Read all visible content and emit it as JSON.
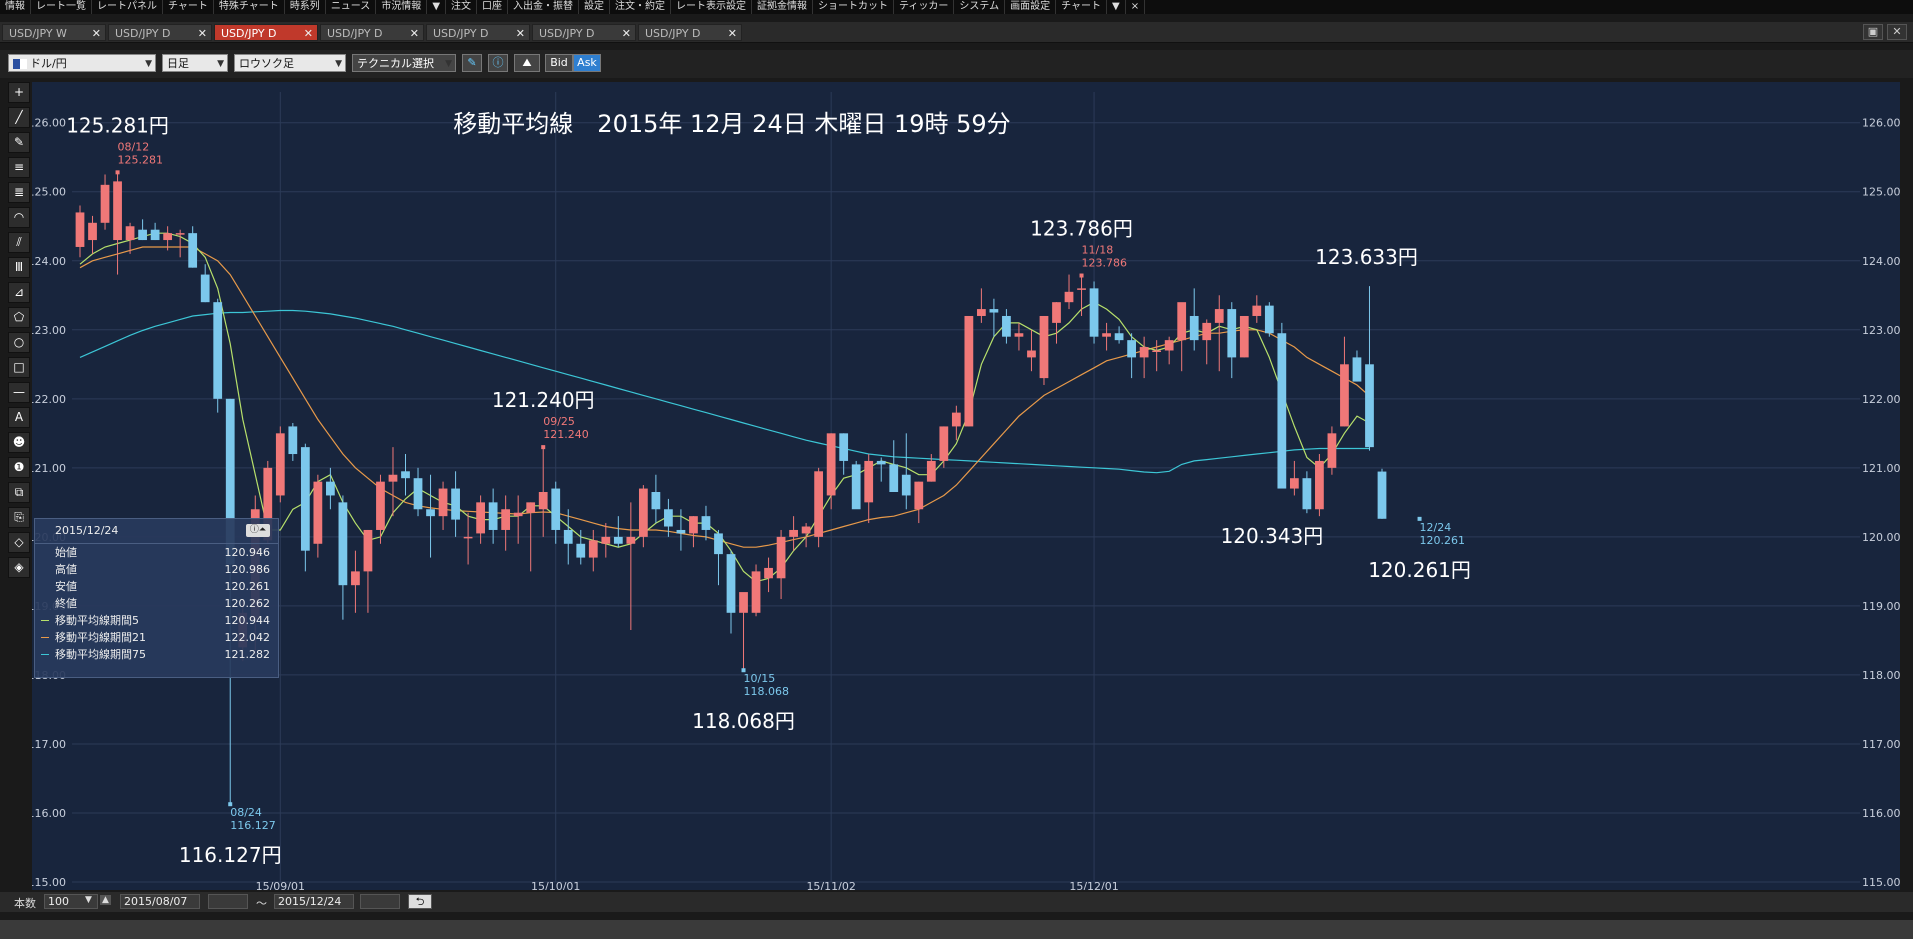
{
  "menu": [
    "情報",
    "レート一覧",
    "レートパネル",
    "チャート",
    "特殊チャート",
    "時系列",
    "ニュース",
    "市況情報",
    "▼",
    "注文",
    "口座",
    "入出金・振替",
    "設定",
    "注文・約定",
    "レート表示設定",
    "証拠金情報",
    "ショートカット",
    "ティッカー",
    "システム",
    "画面設定",
    "チャート",
    "▼",
    "×"
  ],
  "tabs": [
    {
      "label": "USD/JPY W",
      "active": false
    },
    {
      "label": "USD/JPY D",
      "active": false
    },
    {
      "label": "USD/JPY D",
      "active": true
    },
    {
      "label": "USD/JPY D",
      "active": false
    },
    {
      "label": "USD/JPY D",
      "active": false
    },
    {
      "label": "USD/JPY D",
      "active": false
    },
    {
      "label": "USD/JPY D",
      "active": false
    }
  ],
  "toolbar": {
    "pair": "ドル/円",
    "period": "日足",
    "chart_type": "ロウソク足",
    "technical": "テクニカル選択",
    "bid": "Bid",
    "ask": "Ask"
  },
  "left_tools": [
    "+",
    "╱",
    "✎",
    "≡",
    "≣",
    "◠",
    "⫽",
    "Ⅲ",
    "⊿",
    "⬠",
    "○",
    "□",
    "—",
    "A",
    "☻",
    "❶",
    "⧉",
    "⎘",
    "◇",
    "◈"
  ],
  "bottom": {
    "count_label": "本数",
    "count_value": "100",
    "from_date": "2015/08/07",
    "tilde": "～",
    "to_date": "2015/12/24"
  },
  "info_panel": {
    "date": "2015/12/24",
    "rows": [
      {
        "label": "始値",
        "value": "120.946",
        "color": ""
      },
      {
        "label": "高値",
        "value": "120.986",
        "color": ""
      },
      {
        "label": "安値",
        "value": "120.261",
        "color": ""
      },
      {
        "label": "終値",
        "value": "120.262",
        "color": ""
      },
      {
        "label": "移動平均線期間5",
        "value": "120.944",
        "color": "#b7e06b"
      },
      {
        "label": "移動平均線期間21",
        "value": "122.042",
        "color": "#e89a4a"
      },
      {
        "label": "移動平均線期間75",
        "value": "121.282",
        "color": "#3cc6d6"
      }
    ]
  },
  "chart_data": {
    "type": "candlestick",
    "title": "移動平均線　2015年 12月 24日 木曜日 19時 59分",
    "ylim": [
      115,
      126.3
    ],
    "yticks": [
      "115.00",
      "116.00",
      "117.00",
      "118.00",
      "119.00",
      "120.00",
      "121.00",
      "122.00",
      "123.00",
      "124.00",
      "125.00",
      "126.00"
    ],
    "xticks": [
      {
        "label": "15/09/01",
        "i": 16
      },
      {
        "label": "15/10/01",
        "i": 38
      },
      {
        "label": "15/11/02",
        "i": 60
      },
      {
        "label": "15/12/01",
        "i": 81
      }
    ],
    "colors": {
      "up": "#f07878",
      "down": "#7cc8ec",
      "ma5": "#b7e06b",
      "ma21": "#e89a4a",
      "ma75": "#3cc6d6",
      "grid": "#2c3b58",
      "text": "#c8cfdc"
    },
    "candles": [
      [
        124.2,
        124.8,
        124.05,
        124.7
      ],
      [
        124.3,
        124.65,
        124.1,
        124.55
      ],
      [
        124.55,
        125.25,
        124.45,
        125.1
      ],
      [
        124.3,
        125.281,
        123.8,
        125.15
      ],
      [
        124.3,
        124.55,
        124.1,
        124.5
      ],
      [
        124.45,
        124.6,
        124.3,
        124.3
      ],
      [
        124.45,
        124.55,
        124.3,
        124.3
      ],
      [
        124.3,
        124.5,
        124.15,
        124.4
      ],
      [
        124.4,
        124.45,
        124.05,
        124.4
      ],
      [
        124.4,
        124.5,
        123.9,
        123.9
      ],
      [
        123.8,
        123.95,
        123.4,
        123.4
      ],
      [
        123.4,
        123.45,
        121.8,
        122.0
      ],
      [
        122.0,
        122.0,
        116.127,
        119.6
      ],
      [
        118.4,
        119.1,
        118.2,
        118.9
      ],
      [
        118.8,
        120.6,
        118.3,
        120.4
      ],
      [
        119.95,
        121.1,
        119.9,
        121.0
      ],
      [
        120.6,
        121.6,
        120.5,
        121.5
      ],
      [
        121.6,
        121.65,
        121.1,
        121.2
      ],
      [
        121.3,
        121.35,
        119.5,
        119.8
      ],
      [
        119.9,
        120.9,
        119.7,
        120.8
      ],
      [
        120.8,
        121.0,
        120.4,
        120.6
      ],
      [
        120.5,
        120.6,
        118.8,
        119.3
      ],
      [
        119.3,
        119.8,
        118.9,
        119.5
      ],
      [
        119.5,
        120.1,
        118.9,
        120.1
      ],
      [
        120.1,
        120.9,
        119.9,
        120.8
      ],
      [
        120.8,
        121.3,
        120.3,
        120.9
      ],
      [
        120.95,
        121.2,
        120.6,
        120.85
      ],
      [
        120.85,
        121.0,
        120.3,
        120.4
      ],
      [
        120.4,
        120.9,
        119.7,
        120.3
      ],
      [
        120.3,
        120.8,
        120.1,
        120.7
      ],
      [
        120.7,
        120.95,
        120.0,
        120.25
      ],
      [
        120.0,
        120.35,
        119.6,
        120.0
      ],
      [
        120.05,
        120.6,
        119.9,
        120.5
      ],
      [
        120.5,
        120.7,
        119.9,
        120.1
      ],
      [
        120.1,
        120.6,
        119.8,
        120.4
      ],
      [
        120.3,
        120.6,
        119.9,
        120.35
      ],
      [
        120.35,
        120.5,
        119.5,
        120.5
      ],
      [
        120.4,
        121.3,
        120.0,
        120.65
      ],
      [
        120.7,
        120.8,
        119.9,
        120.1
      ],
      [
        120.1,
        120.4,
        119.6,
        119.9
      ],
      [
        119.9,
        120.1,
        119.6,
        119.7
      ],
      [
        119.7,
        120.1,
        119.5,
        119.95
      ],
      [
        119.9,
        120.2,
        119.7,
        120.0
      ],
      [
        120.0,
        120.3,
        119.85,
        119.9
      ],
      [
        119.9,
        120.5,
        118.65,
        120.0
      ],
      [
        120.0,
        120.75,
        119.85,
        120.7
      ],
      [
        120.65,
        120.9,
        120.2,
        120.4
      ],
      [
        120.4,
        120.55,
        120.0,
        120.15
      ],
      [
        120.1,
        120.4,
        119.8,
        120.05
      ],
      [
        120.05,
        120.3,
        119.85,
        120.3
      ],
      [
        120.3,
        120.45,
        119.95,
        120.1
      ],
      [
        120.05,
        120.1,
        119.3,
        119.75
      ],
      [
        119.75,
        119.8,
        118.6,
        118.9
      ],
      [
        118.9,
        119.0,
        118.068,
        119.2
      ],
      [
        118.9,
        119.6,
        118.85,
        119.5
      ],
      [
        119.4,
        119.7,
        119.2,
        119.55
      ],
      [
        119.4,
        120.1,
        119.1,
        120.0
      ],
      [
        120.0,
        120.3,
        119.8,
        120.1
      ],
      [
        120.05,
        120.2,
        119.85,
        120.15
      ],
      [
        120.0,
        121.0,
        119.85,
        120.95
      ],
      [
        120.6,
        121.5,
        120.4,
        121.5
      ],
      [
        121.5,
        121.5,
        120.9,
        121.1
      ],
      [
        121.05,
        121.1,
        120.5,
        120.4
      ],
      [
        120.5,
        121.2,
        120.2,
        121.1
      ],
      [
        121.1,
        121.15,
        120.8,
        121.05
      ],
      [
        121.05,
        121.4,
        120.8,
        120.65
      ],
      [
        120.9,
        121.5,
        120.4,
        120.6
      ],
      [
        120.4,
        120.8,
        120.2,
        120.8
      ],
      [
        120.8,
        121.2,
        120.8,
        121.1
      ],
      [
        121.1,
        121.6,
        121.0,
        121.6
      ],
      [
        121.6,
        121.9,
        121.4,
        121.8
      ],
      [
        121.6,
        123.2,
        121.6,
        123.2
      ],
      [
        123.2,
        123.6,
        123.1,
        123.3
      ],
      [
        123.3,
        123.45,
        122.9,
        123.25
      ],
      [
        123.2,
        123.3,
        122.8,
        122.9
      ],
      [
        122.9,
        123.1,
        122.7,
        122.95
      ],
      [
        122.6,
        123.0,
        122.4,
        122.7
      ],
      [
        122.3,
        123.2,
        122.2,
        123.2
      ],
      [
        123.1,
        123.4,
        122.8,
        123.4
      ],
      [
        123.4,
        123.8,
        123.3,
        123.55
      ],
      [
        123.6,
        123.786,
        123.2,
        123.6
      ],
      [
        123.6,
        123.7,
        122.8,
        122.9
      ],
      [
        122.9,
        123.1,
        122.7,
        122.95
      ],
      [
        122.95,
        123.05,
        122.8,
        122.85
      ],
      [
        122.85,
        122.95,
        122.3,
        122.6
      ],
      [
        122.6,
        122.9,
        122.3,
        122.75
      ],
      [
        122.7,
        122.85,
        122.4,
        122.7
      ],
      [
        122.7,
        122.9,
        122.5,
        122.85
      ],
      [
        122.85,
        123.3,
        122.4,
        123.4
      ],
      [
        123.2,
        123.6,
        122.7,
        122.85
      ],
      [
        122.85,
        123.15,
        122.5,
        123.1
      ],
      [
        123.1,
        123.5,
        122.4,
        123.3
      ],
      [
        123.3,
        123.4,
        122.3,
        122.6
      ],
      [
        122.6,
        123.2,
        122.6,
        123.2
      ],
      [
        123.2,
        123.5,
        123.1,
        123.35
      ],
      [
        123.35,
        123.4,
        122.9,
        122.95
      ],
      [
        122.95,
        123.1,
        120.8,
        120.7
      ],
      [
        120.7,
        121.1,
        120.6,
        120.85
      ],
      [
        120.85,
        120.95,
        120.343,
        120.4
      ],
      [
        120.4,
        121.2,
        120.3,
        121.1
      ],
      [
        121.0,
        121.6,
        120.9,
        121.5
      ],
      [
        121.6,
        122.9,
        121.6,
        122.5
      ],
      [
        122.6,
        122.7,
        122.25,
        122.25
      ],
      [
        122.5,
        123.633,
        121.25,
        121.3
      ]
    ],
    "ma5_start": [
      0,
      123.95
    ],
    "ma5": [
      123.95,
      124.1,
      124.2,
      124.25,
      124.3,
      124.35,
      124.4,
      124.4,
      124.35,
      124.25,
      124.05,
      123.6,
      122.8,
      121.7,
      120.9,
      120.1,
      120.1,
      120.4,
      120.5,
      120.8,
      120.9,
      120.5,
      120.2,
      119.95,
      120.0,
      120.35,
      120.55,
      120.7,
      120.6,
      120.5,
      120.45,
      120.3,
      120.25,
      120.25,
      120.3,
      120.3,
      120.45,
      120.45,
      120.3,
      120.15,
      120.0,
      119.95,
      119.9,
      119.85,
      119.9,
      120.05,
      120.2,
      120.3,
      120.3,
      120.2,
      120.2,
      120.05,
      119.8,
      119.5,
      119.35,
      119.4,
      119.55,
      119.8,
      120.0,
      120.3,
      120.6,
      120.85,
      120.9,
      121.0,
      121.1,
      121.05,
      121.0,
      120.9,
      120.9,
      121.1,
      121.35,
      121.8,
      122.5,
      122.9,
      123.1,
      123.1,
      123.0,
      122.9,
      122.95,
      123.1,
      123.3,
      123.4,
      123.3,
      123.15,
      122.9,
      122.75,
      122.7,
      122.75,
      122.95,
      123.0,
      122.95,
      123.05,
      123.0,
      123.05,
      123.0,
      122.6,
      122.1,
      121.6,
      121.15,
      121.0,
      121.2,
      121.5,
      121.75,
      121.65
    ],
    "ma21": [
      123.9,
      124.0,
      124.05,
      124.1,
      124.15,
      124.2,
      124.2,
      124.2,
      124.2,
      124.2,
      124.1,
      124.0,
      123.8,
      123.5,
      123.2,
      122.9,
      122.6,
      122.3,
      122.0,
      121.7,
      121.45,
      121.2,
      121.0,
      120.85,
      120.7,
      120.6,
      120.5,
      120.45,
      120.42,
      120.4,
      120.38,
      120.37,
      120.36,
      120.35,
      120.34,
      120.33,
      120.35,
      120.36,
      120.35,
      120.3,
      120.25,
      120.2,
      120.15,
      120.12,
      120.1,
      120.1,
      120.1,
      120.08,
      120.05,
      120.02,
      120.0,
      119.95,
      119.9,
      119.85,
      119.85,
      119.88,
      119.92,
      119.96,
      120.0,
      120.05,
      120.1,
      120.15,
      120.2,
      120.25,
      120.28,
      120.3,
      120.35,
      120.4,
      120.5,
      120.6,
      120.75,
      120.95,
      121.15,
      121.35,
      121.55,
      121.75,
      121.9,
      122.05,
      122.15,
      122.25,
      122.35,
      122.45,
      122.55,
      122.6,
      122.65,
      122.7,
      122.75,
      122.8,
      122.85,
      122.9,
      122.95,
      122.95,
      122.98,
      123.0,
      123.0,
      122.95,
      122.85,
      122.75,
      122.6,
      122.5,
      122.4,
      122.3,
      122.2,
      122.04
    ],
    "ma75": [
      122.6,
      122.68,
      122.76,
      122.84,
      122.92,
      122.99,
      123.05,
      123.1,
      123.15,
      123.2,
      123.22,
      123.24,
      123.25,
      123.25,
      123.26,
      123.27,
      123.28,
      123.28,
      123.27,
      123.25,
      123.23,
      123.2,
      123.17,
      123.13,
      123.09,
      123.05,
      123.0,
      122.95,
      122.9,
      122.85,
      122.8,
      122.75,
      122.7,
      122.65,
      122.6,
      122.55,
      122.5,
      122.45,
      122.4,
      122.35,
      122.3,
      122.25,
      122.2,
      122.15,
      122.1,
      122.05,
      122.0,
      121.95,
      121.9,
      121.85,
      121.8,
      121.75,
      121.7,
      121.65,
      121.6,
      121.55,
      121.5,
      121.45,
      121.4,
      121.36,
      121.32,
      121.28,
      121.24,
      121.2,
      121.18,
      121.16,
      121.15,
      121.14,
      121.13,
      121.12,
      121.11,
      121.1,
      121.09,
      121.08,
      121.07,
      121.06,
      121.05,
      121.04,
      121.03,
      121.02,
      121.01,
      121.0,
      120.99,
      120.98,
      120.96,
      120.94,
      120.93,
      120.95,
      121.05,
      121.1,
      121.12,
      121.14,
      121.16,
      121.18,
      121.2,
      121.22,
      121.24,
      121.26,
      121.27,
      121.28,
      121.28,
      121.28,
      121.28,
      121.28
    ],
    "last_candle": [
      120.946,
      120.986,
      120.261,
      120.262
    ],
    "annotations": [
      {
        "i": 3,
        "price": 125.281,
        "date": "08/12",
        "value": "125.281",
        "big": "125.281円",
        "pos": "top",
        "color": "#f07878"
      },
      {
        "i": 12,
        "price": 116.127,
        "date": "08/24",
        "value": "116.127",
        "big": "116.127円",
        "pos": "bottom",
        "color": "#7cc8ec"
      },
      {
        "i": 37,
        "price": 121.3,
        "date": "09/25",
        "value": "121.240",
        "big": "121.240円",
        "pos": "top",
        "color": "#f07878"
      },
      {
        "i": 53,
        "price": 118.068,
        "date": "10/15",
        "value": "118.068",
        "big": "118.068円",
        "pos": "bottom",
        "color": "#7cc8ec"
      },
      {
        "i": 80,
        "price": 123.786,
        "date": "11/18",
        "value": "123.786",
        "big": "123.786円",
        "pos": "top",
        "color": "#f07878"
      },
      {
        "i": 105,
        "price": 123.633,
        "date": "",
        "value": "",
        "big": "123.633円",
        "pos": "top",
        "color": "#f07878"
      },
      {
        "i": 100,
        "price": 120.343,
        "date": "",
        "value": "",
        "big": "120.343円",
        "pos": "bottom",
        "color": "#7cc8ec"
      },
      {
        "i": 107,
        "price": 120.261,
        "date": "12/24",
        "value": "120.261",
        "big": "120.261円",
        "pos": "bottom",
        "color": "#7cc8ec"
      }
    ]
  }
}
